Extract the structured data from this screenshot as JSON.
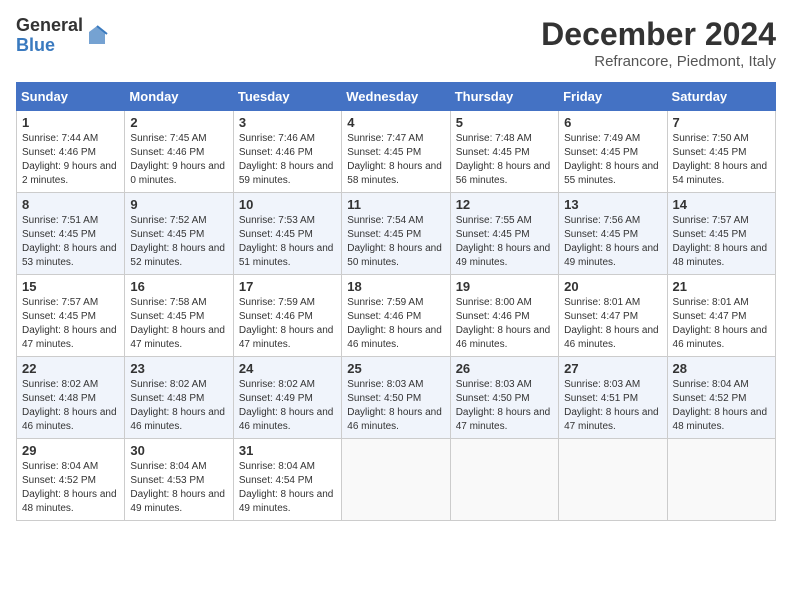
{
  "logo": {
    "general": "General",
    "blue": "Blue"
  },
  "calendar": {
    "title": "December 2024",
    "subtitle": "Refrancore, Piedmont, Italy"
  },
  "weekdays": [
    "Sunday",
    "Monday",
    "Tuesday",
    "Wednesday",
    "Thursday",
    "Friday",
    "Saturday"
  ],
  "weeks": [
    [
      {
        "day": "1",
        "sunrise": "Sunrise: 7:44 AM",
        "sunset": "Sunset: 4:46 PM",
        "daylight": "Daylight: 9 hours and 2 minutes."
      },
      {
        "day": "2",
        "sunrise": "Sunrise: 7:45 AM",
        "sunset": "Sunset: 4:46 PM",
        "daylight": "Daylight: 9 hours and 0 minutes."
      },
      {
        "day": "3",
        "sunrise": "Sunrise: 7:46 AM",
        "sunset": "Sunset: 4:46 PM",
        "daylight": "Daylight: 8 hours and 59 minutes."
      },
      {
        "day": "4",
        "sunrise": "Sunrise: 7:47 AM",
        "sunset": "Sunset: 4:45 PM",
        "daylight": "Daylight: 8 hours and 58 minutes."
      },
      {
        "day": "5",
        "sunrise": "Sunrise: 7:48 AM",
        "sunset": "Sunset: 4:45 PM",
        "daylight": "Daylight: 8 hours and 56 minutes."
      },
      {
        "day": "6",
        "sunrise": "Sunrise: 7:49 AM",
        "sunset": "Sunset: 4:45 PM",
        "daylight": "Daylight: 8 hours and 55 minutes."
      },
      {
        "day": "7",
        "sunrise": "Sunrise: 7:50 AM",
        "sunset": "Sunset: 4:45 PM",
        "daylight": "Daylight: 8 hours and 54 minutes."
      }
    ],
    [
      {
        "day": "8",
        "sunrise": "Sunrise: 7:51 AM",
        "sunset": "Sunset: 4:45 PM",
        "daylight": "Daylight: 8 hours and 53 minutes."
      },
      {
        "day": "9",
        "sunrise": "Sunrise: 7:52 AM",
        "sunset": "Sunset: 4:45 PM",
        "daylight": "Daylight: 8 hours and 52 minutes."
      },
      {
        "day": "10",
        "sunrise": "Sunrise: 7:53 AM",
        "sunset": "Sunset: 4:45 PM",
        "daylight": "Daylight: 8 hours and 51 minutes."
      },
      {
        "day": "11",
        "sunrise": "Sunrise: 7:54 AM",
        "sunset": "Sunset: 4:45 PM",
        "daylight": "Daylight: 8 hours and 50 minutes."
      },
      {
        "day": "12",
        "sunrise": "Sunrise: 7:55 AM",
        "sunset": "Sunset: 4:45 PM",
        "daylight": "Daylight: 8 hours and 49 minutes."
      },
      {
        "day": "13",
        "sunrise": "Sunrise: 7:56 AM",
        "sunset": "Sunset: 4:45 PM",
        "daylight": "Daylight: 8 hours and 49 minutes."
      },
      {
        "day": "14",
        "sunrise": "Sunrise: 7:57 AM",
        "sunset": "Sunset: 4:45 PM",
        "daylight": "Daylight: 8 hours and 48 minutes."
      }
    ],
    [
      {
        "day": "15",
        "sunrise": "Sunrise: 7:57 AM",
        "sunset": "Sunset: 4:45 PM",
        "daylight": "Daylight: 8 hours and 47 minutes."
      },
      {
        "day": "16",
        "sunrise": "Sunrise: 7:58 AM",
        "sunset": "Sunset: 4:45 PM",
        "daylight": "Daylight: 8 hours and 47 minutes."
      },
      {
        "day": "17",
        "sunrise": "Sunrise: 7:59 AM",
        "sunset": "Sunset: 4:46 PM",
        "daylight": "Daylight: 8 hours and 47 minutes."
      },
      {
        "day": "18",
        "sunrise": "Sunrise: 7:59 AM",
        "sunset": "Sunset: 4:46 PM",
        "daylight": "Daylight: 8 hours and 46 minutes."
      },
      {
        "day": "19",
        "sunrise": "Sunrise: 8:00 AM",
        "sunset": "Sunset: 4:46 PM",
        "daylight": "Daylight: 8 hours and 46 minutes."
      },
      {
        "day": "20",
        "sunrise": "Sunrise: 8:01 AM",
        "sunset": "Sunset: 4:47 PM",
        "daylight": "Daylight: 8 hours and 46 minutes."
      },
      {
        "day": "21",
        "sunrise": "Sunrise: 8:01 AM",
        "sunset": "Sunset: 4:47 PM",
        "daylight": "Daylight: 8 hours and 46 minutes."
      }
    ],
    [
      {
        "day": "22",
        "sunrise": "Sunrise: 8:02 AM",
        "sunset": "Sunset: 4:48 PM",
        "daylight": "Daylight: 8 hours and 46 minutes."
      },
      {
        "day": "23",
        "sunrise": "Sunrise: 8:02 AM",
        "sunset": "Sunset: 4:48 PM",
        "daylight": "Daylight: 8 hours and 46 minutes."
      },
      {
        "day": "24",
        "sunrise": "Sunrise: 8:02 AM",
        "sunset": "Sunset: 4:49 PM",
        "daylight": "Daylight: 8 hours and 46 minutes."
      },
      {
        "day": "25",
        "sunrise": "Sunrise: 8:03 AM",
        "sunset": "Sunset: 4:50 PM",
        "daylight": "Daylight: 8 hours and 46 minutes."
      },
      {
        "day": "26",
        "sunrise": "Sunrise: 8:03 AM",
        "sunset": "Sunset: 4:50 PM",
        "daylight": "Daylight: 8 hours and 47 minutes."
      },
      {
        "day": "27",
        "sunrise": "Sunrise: 8:03 AM",
        "sunset": "Sunset: 4:51 PM",
        "daylight": "Daylight: 8 hours and 47 minutes."
      },
      {
        "day": "28",
        "sunrise": "Sunrise: 8:04 AM",
        "sunset": "Sunset: 4:52 PM",
        "daylight": "Daylight: 8 hours and 48 minutes."
      }
    ],
    [
      {
        "day": "29",
        "sunrise": "Sunrise: 8:04 AM",
        "sunset": "Sunset: 4:52 PM",
        "daylight": "Daylight: 8 hours and 48 minutes."
      },
      {
        "day": "30",
        "sunrise": "Sunrise: 8:04 AM",
        "sunset": "Sunset: 4:53 PM",
        "daylight": "Daylight: 8 hours and 49 minutes."
      },
      {
        "day": "31",
        "sunrise": "Sunrise: 8:04 AM",
        "sunset": "Sunset: 4:54 PM",
        "daylight": "Daylight: 8 hours and 49 minutes."
      },
      null,
      null,
      null,
      null
    ]
  ]
}
